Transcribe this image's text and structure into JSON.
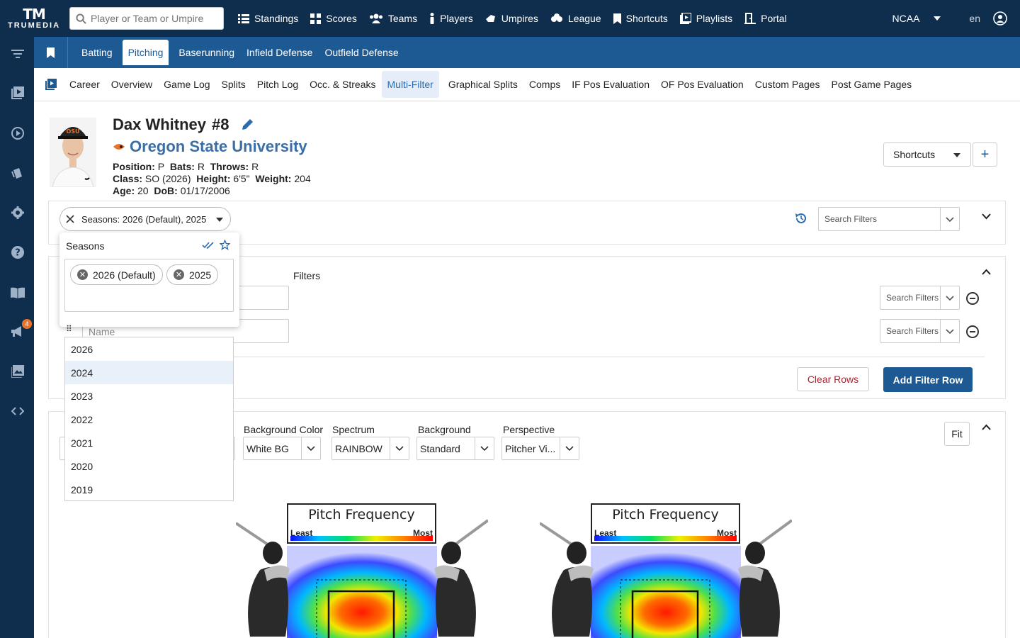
{
  "app": {
    "logo_word": "TRUMEDIA",
    "logo_mark": "TM"
  },
  "search": {
    "placeholder": "Player or Team or Umpire"
  },
  "nav": [
    {
      "label": "Standings",
      "icon": "list-icon"
    },
    {
      "label": "Scores",
      "icon": "grid-icon"
    },
    {
      "label": "Teams",
      "icon": "people-icon"
    },
    {
      "label": "Players",
      "icon": "person-icon"
    },
    {
      "label": "Umpires",
      "icon": "umpire-icon"
    },
    {
      "label": "League",
      "icon": "league-icon"
    },
    {
      "label": "Shortcuts",
      "icon": "bookmark-icon"
    },
    {
      "label": "Playlists",
      "icon": "playlist-icon"
    },
    {
      "label": "Portal",
      "icon": "portal-icon"
    }
  ],
  "top_right": {
    "league": "NCAA",
    "lang": "en"
  },
  "sidebar": {
    "notification_count": "4"
  },
  "section_tabs": [
    "Batting",
    "Pitching",
    "Baserunning",
    "Infield Defense",
    "Outfield Defense"
  ],
  "section_active": "Pitching",
  "sub_tabs": [
    "Career",
    "Overview",
    "Game Log",
    "Splits",
    "Pitch Log",
    "Occ. & Streaks",
    "Multi-Filter",
    "Graphical Splits",
    "Comps",
    "IF Pos Evaluation",
    "OF Pos Evaluation",
    "Custom Pages",
    "Post Game Pages"
  ],
  "sub_active": "Multi-Filter",
  "player": {
    "name": "Dax Whitney",
    "number": "#8",
    "team": "Oregon State University",
    "cap_text": "OSU",
    "position_label": "Position:",
    "position": "P",
    "bats_label": "Bats:",
    "bats": "R",
    "throws_label": "Throws:",
    "throws": "R",
    "class_label": "Class:",
    "class": "SO (2026)",
    "height_label": "Height:",
    "height": "6'5\"",
    "weight_label": "Weight:",
    "weight": "204",
    "age_label": "Age:",
    "age": "20",
    "dob_label": "DoB:",
    "dob": "01/17/2006"
  },
  "header_actions": {
    "shortcuts": "Shortcuts",
    "plus": "+"
  },
  "filter_bar": {
    "season_chip": "Seasons: 2026 (Default), 2025",
    "search_filters": "Search Filters"
  },
  "seasons_popover": {
    "title": "Seasons",
    "selected": [
      "2026 (Default)",
      "2025"
    ]
  },
  "season_options": [
    "2026",
    "2024",
    "2023",
    "2022",
    "2021",
    "2020",
    "2019"
  ],
  "season_highlight": "2024",
  "rows": {
    "filters_label": "Filters",
    "name_placeholder": "Name",
    "search_filters": "Search Filters",
    "clear": "Clear Rows",
    "add": "Add Filter Row"
  },
  "heatmap_controls": {
    "background_color_label": "Background Color",
    "background_color": "White BG",
    "spectrum_label": "Spectrum",
    "spectrum": "RAINBOW",
    "background_label": "Background",
    "background": "Standard",
    "perspective_label": "Perspective",
    "perspective": "Pitcher Vi...",
    "fit": "Fit"
  },
  "heatmaps": [
    {
      "title": "Pitch Frequency",
      "least": "Least",
      "most": "Most"
    },
    {
      "title": "Pitch Frequency",
      "least": "Least",
      "most": "Most"
    }
  ],
  "colors": {
    "primary": "#0f2e4e",
    "secondary": "#1d5a93",
    "accent": "#3a6ea5",
    "danger": "#b51f2d",
    "badge": "#e8742b"
  }
}
